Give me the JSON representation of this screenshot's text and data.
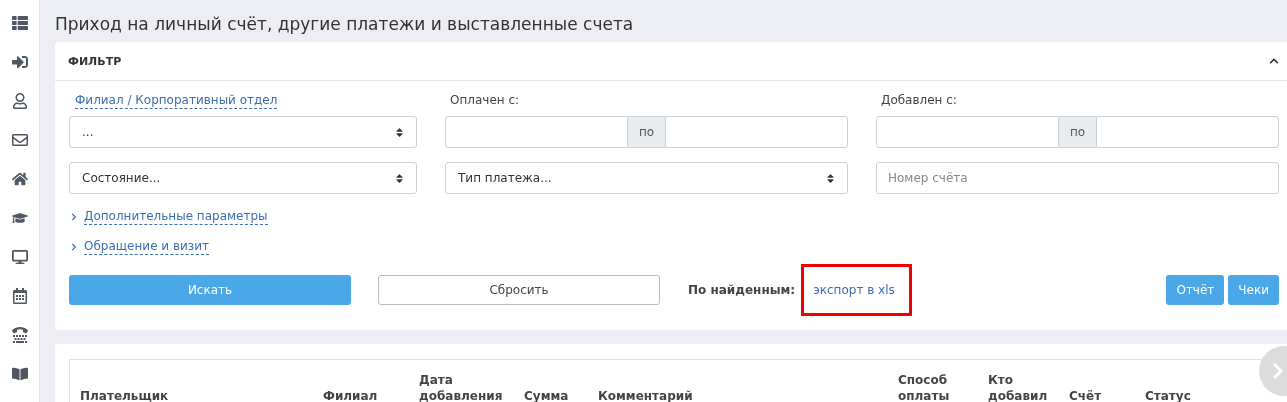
{
  "page_title": "Приход на личный счёт, другие платежи и выставленные счета",
  "filter": {
    "title": "ФИЛЬТР",
    "expanded": true,
    "branch_label": "Филиал / Корпоративный отдел",
    "branch_select": "...",
    "paid_label": "Оплачен с:",
    "paid_separator": "по",
    "added_label": "Добавлен с:",
    "added_separator": "по",
    "state_select": "Состояние...",
    "payment_type_select": "Тип платежа...",
    "invoice_placeholder": "Номер счёта",
    "toggles": [
      {
        "label": "Дополнительные параметры",
        "expanded": false
      },
      {
        "label": "Обращение и визит",
        "expanded": false
      }
    ],
    "search_button": "Искать",
    "reset_button": "Сбросить",
    "found_label": "По найденным:",
    "export_link": {
      "label": "экспорт в xls",
      "highlighted": true
    },
    "right_buttons": [
      "Отчёт",
      "Чеки"
    ]
  },
  "table": {
    "columns": [
      {
        "label": "Плательщик"
      },
      {
        "label": "Филиал"
      },
      {
        "label": "Дата добавления"
      },
      {
        "label": "Сумма"
      },
      {
        "label": "Комментарий"
      },
      {
        "label": "Способ оплаты"
      },
      {
        "label": "Кто добавил"
      },
      {
        "label": "Счёт"
      },
      {
        "label": "Статус"
      }
    ]
  }
}
